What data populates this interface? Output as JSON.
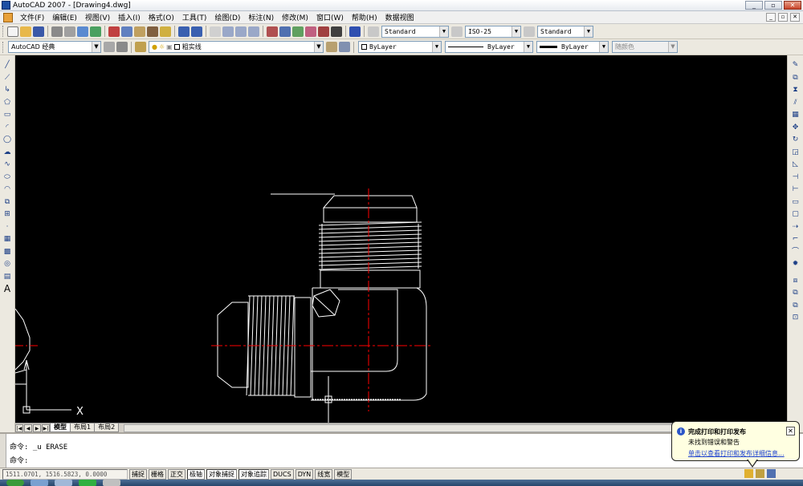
{
  "window": {
    "title": "AutoCAD 2007 - [Drawing4.dwg]"
  },
  "menu": [
    "文件(F)",
    "编辑(E)",
    "视图(V)",
    "插入(I)",
    "格式(O)",
    "工具(T)",
    "绘图(D)",
    "标注(N)",
    "修改(M)",
    "窗口(W)",
    "帮助(H)",
    "数据视图"
  ],
  "toolbar1": {
    "text_style": "Standard",
    "dim_style": "ISO-25",
    "table_style": "Standard"
  },
  "toolbar2": {
    "workspace": "AutoCAD 经典",
    "layer": "粗实线",
    "color": "ByLayer",
    "linetype": "ByLayer",
    "lineweight": "ByLayer",
    "plot_style": "随颜色"
  },
  "canvas": {
    "background": "#000000",
    "ucs_x_label": "X"
  },
  "tabs": {
    "model": "模型",
    "layout1": "布局1",
    "layout2": "布局2"
  },
  "command": {
    "line1": "命令: _u ERASE",
    "line2": "命令:"
  },
  "status": {
    "coords": "1511.0701, 1516.5823, 0.0000",
    "buttons": [
      "捕捉",
      "栅格",
      "正交",
      "极轴",
      "对象捕捉",
      "对象追踪",
      "DUCS",
      "DYN",
      "线宽",
      "模型"
    ]
  },
  "balloon": {
    "title": "完成打印和打印发布",
    "line": "未找到错误和警告",
    "link": "单击以查看打印和发布详细信息..."
  },
  "colors": {
    "accent": "#1a3fd0",
    "centerline": "#ff0000",
    "geometry": "#ffffff"
  }
}
